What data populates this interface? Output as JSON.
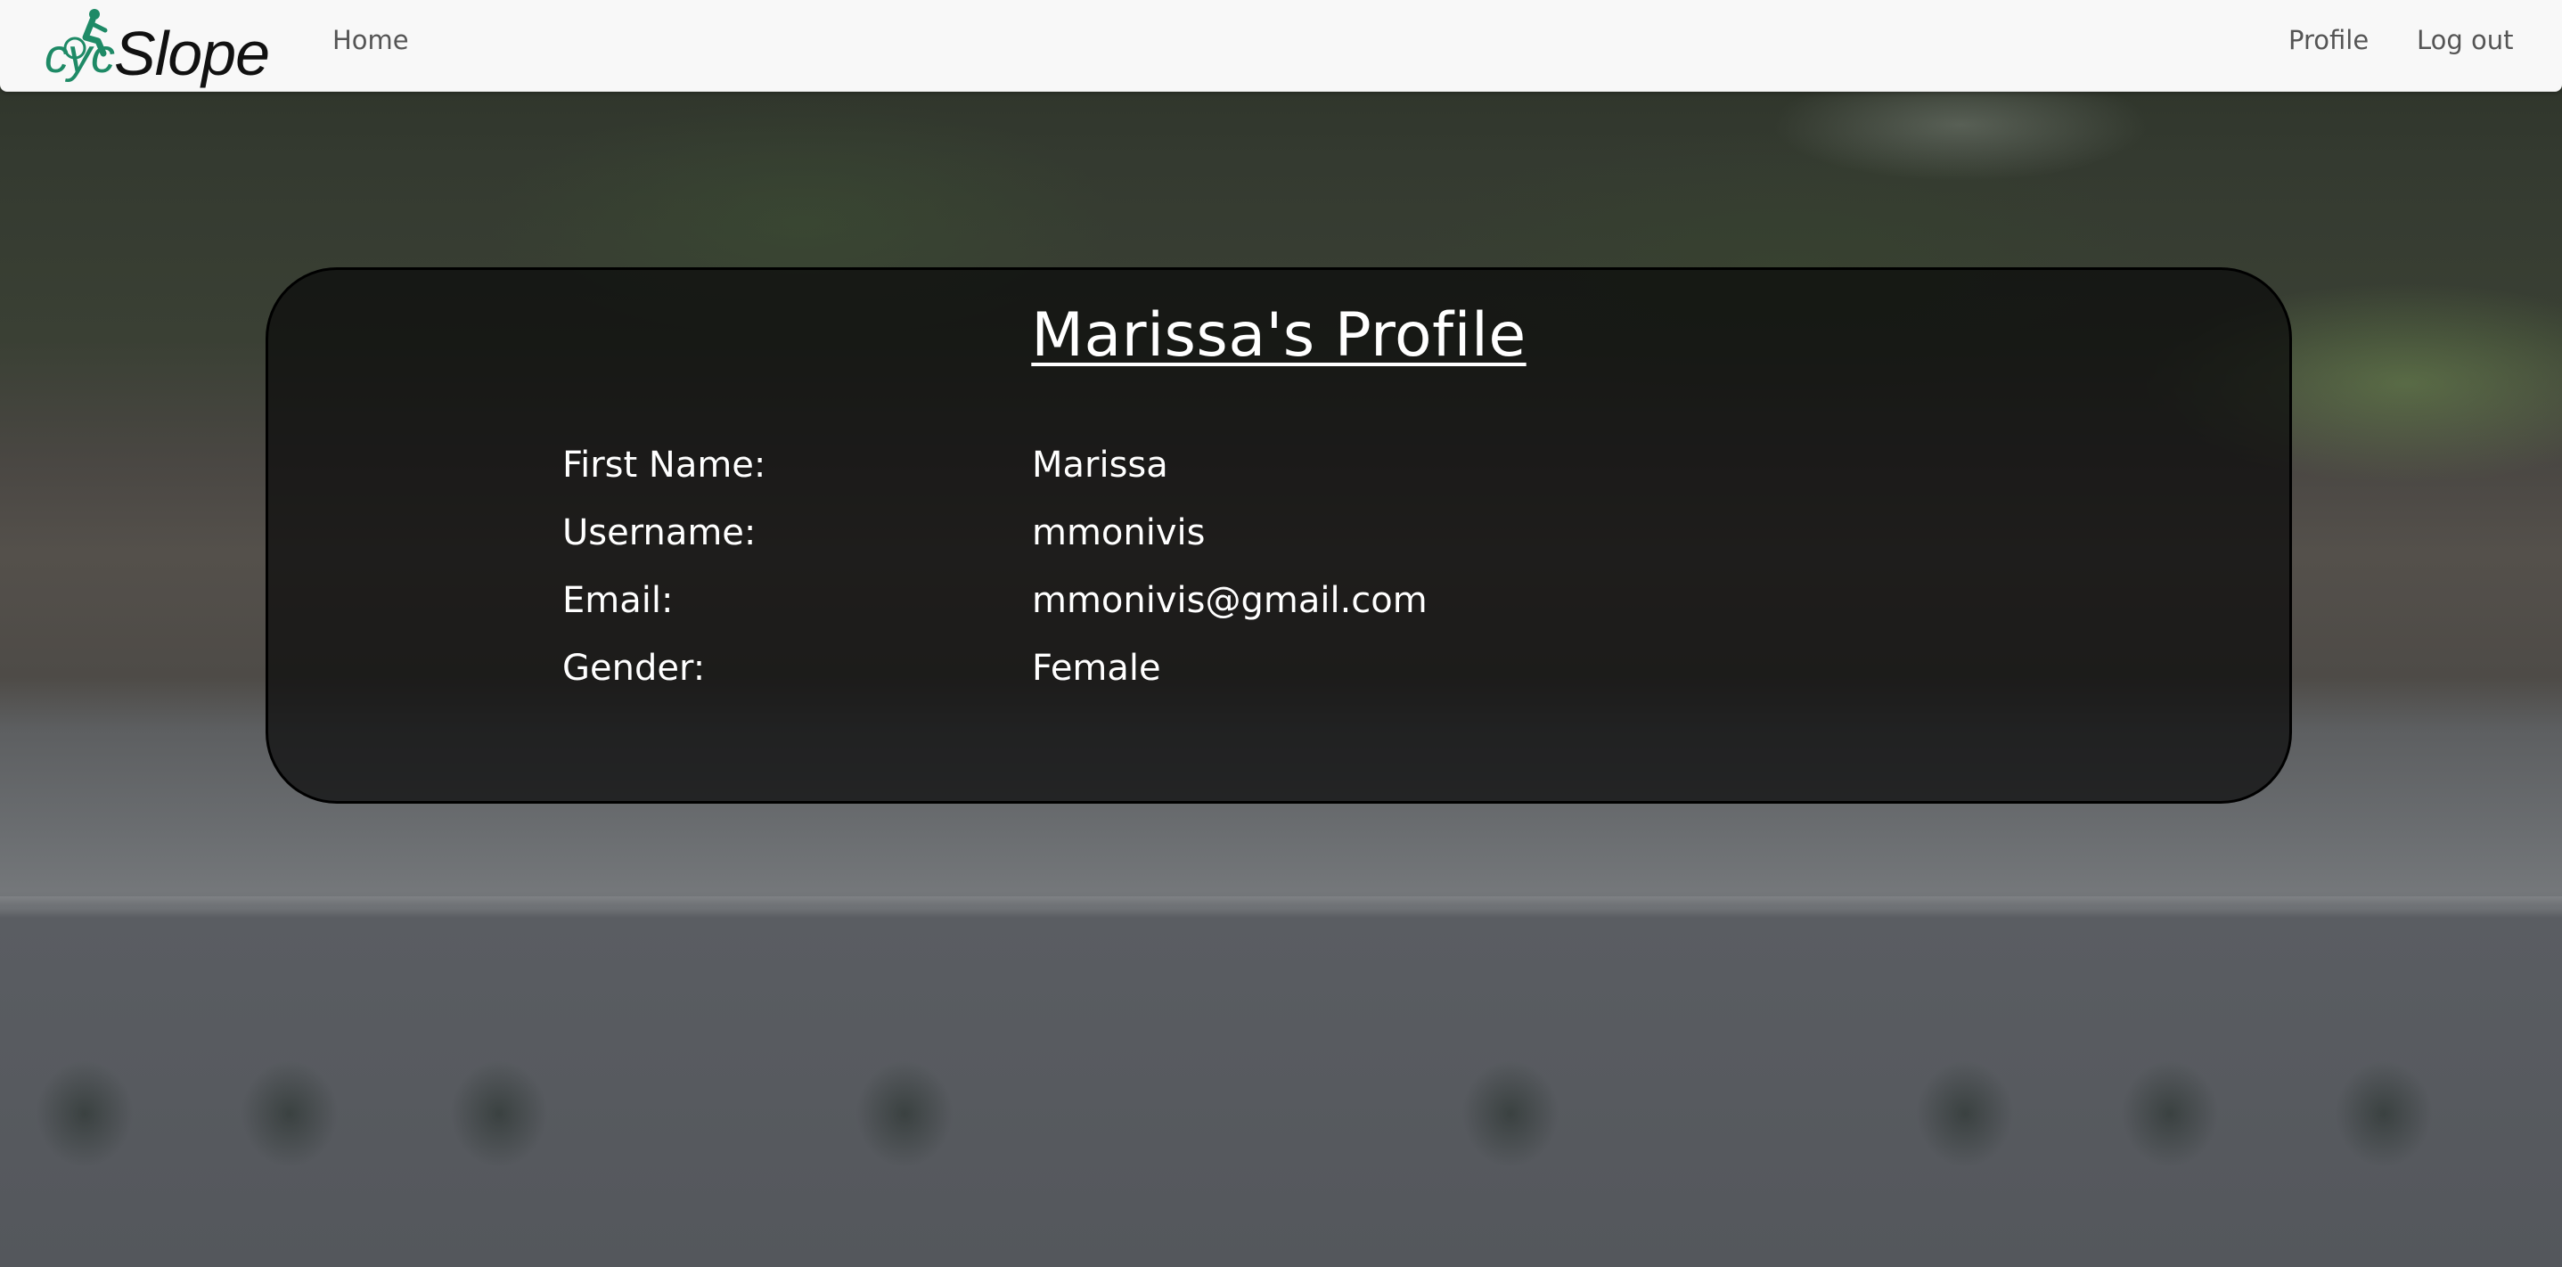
{
  "navbar": {
    "logo": {
      "prefix": "cyc",
      "name": "Slope",
      "accent_color": "#1e8a66",
      "icon": "cyclist-icon"
    },
    "home_label": "Home",
    "profile_label": "Profile",
    "logout_label": "Log out"
  },
  "profile": {
    "title": "Marissa's Profile",
    "fields": [
      {
        "label": "First Name:",
        "value": "Marissa"
      },
      {
        "label": "Username:",
        "value": "mmonivis"
      },
      {
        "label": "Email:",
        "value": "mmonivis@gmail.com"
      },
      {
        "label": "Gender:",
        "value": "Female"
      }
    ]
  }
}
